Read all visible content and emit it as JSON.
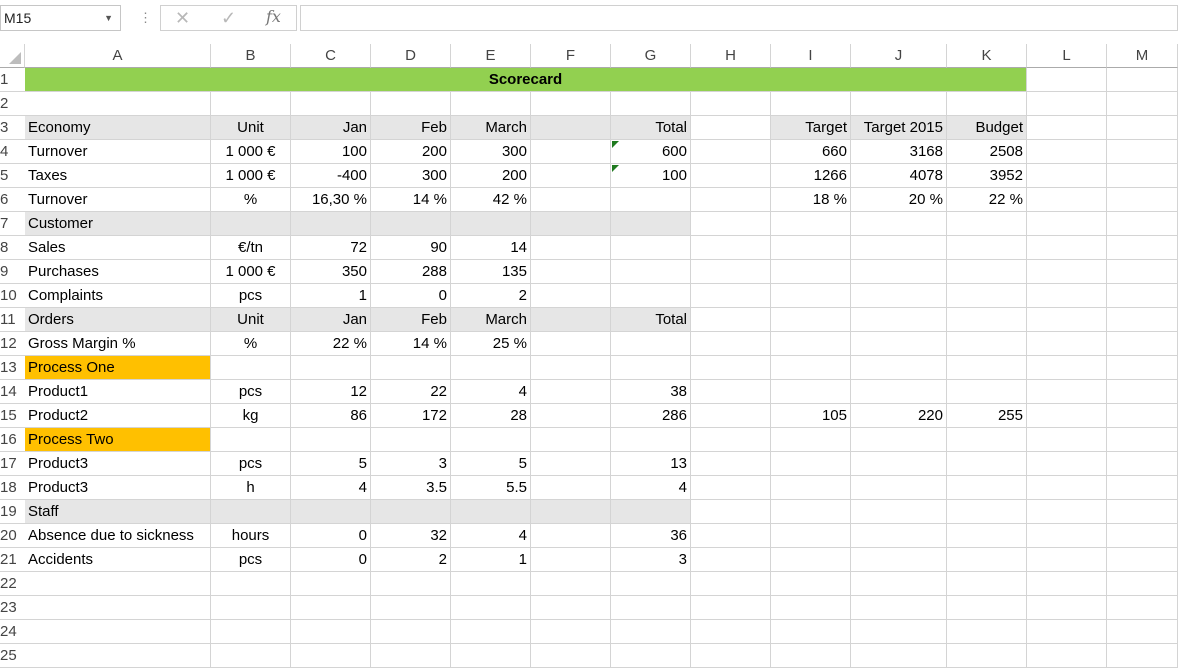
{
  "formula_bar": {
    "name_box": "M15",
    "formula": ""
  },
  "columns": [
    "A",
    "B",
    "C",
    "D",
    "E",
    "F",
    "G",
    "H",
    "I",
    "J",
    "K",
    "L",
    "M"
  ],
  "rows": [
    "1",
    "2",
    "3",
    "4",
    "5",
    "6",
    "7",
    "8",
    "9",
    "10",
    "11",
    "12",
    "13",
    "14",
    "15",
    "16",
    "17",
    "18",
    "19",
    "20",
    "21",
    "22",
    "23",
    "24",
    "25"
  ],
  "sheet": {
    "title": "Scorecard",
    "r3": {
      "a": "Economy",
      "b": "Unit",
      "c": "Jan",
      "d": "Feb",
      "e": "March",
      "g": "Total",
      "i": "Target",
      "j": "Target 2015",
      "k": "Budget"
    },
    "r4": {
      "a": "Turnover",
      "b": "1 000 €",
      "c": "100",
      "d": "200",
      "e": "300",
      "g": "600",
      "i": "660",
      "j": "3168",
      "k": "2508"
    },
    "r5": {
      "a": "Taxes",
      "b": "1 000 €",
      "c": "-400",
      "d": "300",
      "e": "200",
      "g": "100",
      "i": "1266",
      "j": "4078",
      "k": "3952"
    },
    "r6": {
      "a": "Turnover",
      "b": "%",
      "c": "16,30 %",
      "d": "14 %",
      "e": "42 %",
      "i": "18 %",
      "j": "20 %",
      "k": "22 %"
    },
    "r7": {
      "a": "Customer"
    },
    "r8": {
      "a": "Sales",
      "b": "€/tn",
      "c": "72",
      "d": "90",
      "e": "14"
    },
    "r9": {
      "a": "Purchases",
      "b": "1 000 €",
      "c": "350",
      "d": "288",
      "e": "135"
    },
    "r10": {
      "a": "Complaints",
      "b": "pcs",
      "c": "1",
      "d": "0",
      "e": "2"
    },
    "r11": {
      "a": "Orders",
      "b": "Unit",
      "c": "Jan",
      "d": "Feb",
      "e": "March",
      "g": "Total"
    },
    "r12": {
      "a": "Gross Margin %",
      "b": "%",
      "c": "22 %",
      "d": "14 %",
      "e": "25 %"
    },
    "r13": {
      "a": "Process One"
    },
    "r14": {
      "a": "Product1",
      "b": "pcs",
      "c": "12",
      "d": "22",
      "e": "4",
      "g": "38"
    },
    "r15": {
      "a": "Product2",
      "b": "kg",
      "c": "86",
      "d": "172",
      "e": "28",
      "g": "286",
      "i": "105",
      "j": "220",
      "k": "255"
    },
    "r16": {
      "a": "Process Two"
    },
    "r17": {
      "a": "Product3",
      "b": "pcs",
      "c": "5",
      "d": "3",
      "e": "5",
      "g": "13"
    },
    "r18": {
      "a": "Product3",
      "b": "h",
      "c": "4",
      "d": "3.5",
      "e": "5.5",
      "g": "4"
    },
    "r19": {
      "a": "Staff"
    },
    "r20": {
      "a": "Absence due to sickness",
      "b": "hours",
      "c": "0",
      "d": "32",
      "e": "4",
      "g": "36"
    },
    "r21": {
      "a": "Accidents",
      "b": "pcs",
      "c": "0",
      "d": "2",
      "e": "1",
      "g": "3"
    }
  },
  "colors": {
    "title_fill": "#92d050",
    "section_fill": "#e6e6e6",
    "process_fill": "#ffc000",
    "error_flag": "#1f7a1f"
  }
}
